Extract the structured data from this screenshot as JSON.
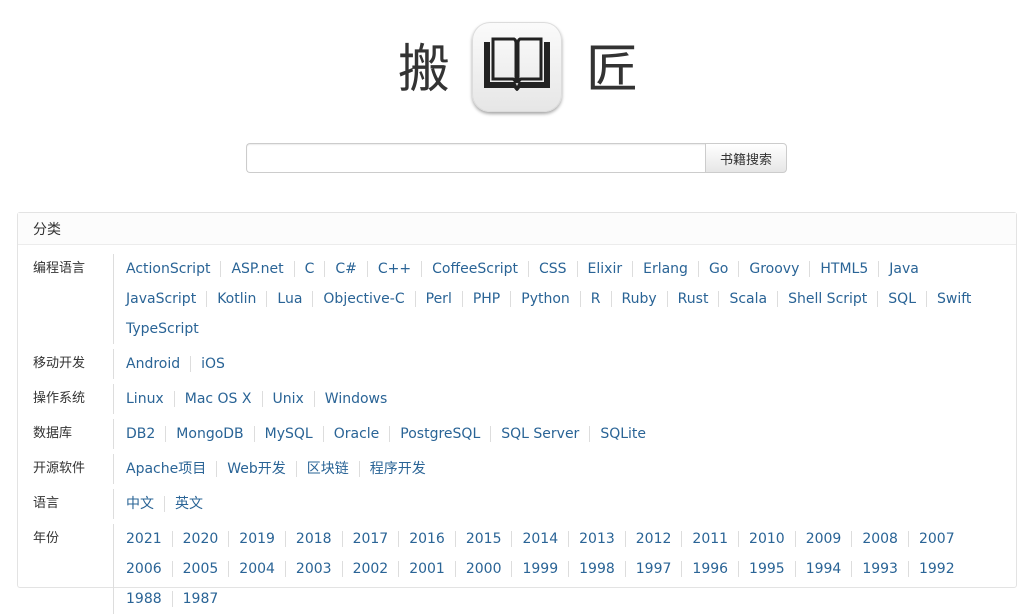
{
  "logo": {
    "char_left": "搬",
    "char_right": "匠",
    "icon": "open-book-icon"
  },
  "search": {
    "value": "",
    "placeholder": "",
    "button_label": "书籍搜索"
  },
  "panel": {
    "heading": "分类"
  },
  "categories": [
    {
      "label": "编程语言",
      "items": [
        "ActionScript",
        "ASP.net",
        "C",
        "C#",
        "C++",
        "CoffeeScript",
        "CSS",
        "Elixir",
        "Erlang",
        "Go",
        "Groovy",
        "HTML5",
        "Java",
        "JavaScript",
        "Kotlin",
        "Lua",
        "Objective-C",
        "Perl",
        "PHP",
        "Python",
        "R",
        "Ruby",
        "Rust",
        "Scala",
        "Shell Script",
        "SQL",
        "Swift",
        "TypeScript"
      ]
    },
    {
      "label": "移动开发",
      "items": [
        "Android",
        "iOS"
      ]
    },
    {
      "label": "操作系统",
      "items": [
        "Linux",
        "Mac OS X",
        "Unix",
        "Windows"
      ]
    },
    {
      "label": "数据库",
      "items": [
        "DB2",
        "MongoDB",
        "MySQL",
        "Oracle",
        "PostgreSQL",
        "SQL Server",
        "SQLite"
      ]
    },
    {
      "label": "开源软件",
      "items": [
        "Apache项目",
        "Web开发",
        "区块链",
        "程序开发"
      ]
    },
    {
      "label": "语言",
      "items": [
        "中文",
        "英文"
      ]
    },
    {
      "label": "年份",
      "items": [
        "2021",
        "2020",
        "2019",
        "2018",
        "2017",
        "2016",
        "2015",
        "2014",
        "2013",
        "2012",
        "2011",
        "2010",
        "2009",
        "2008",
        "2007",
        "2006",
        "2005",
        "2004",
        "2003",
        "2002",
        "2001",
        "2000",
        "1999",
        "1998",
        "1997",
        "1996",
        "1995",
        "1994",
        "1993",
        "1992",
        "1988",
        "1987"
      ]
    }
  ],
  "colors": {
    "link": "#2a6496",
    "text": "#333333",
    "border": "#dddddd"
  }
}
